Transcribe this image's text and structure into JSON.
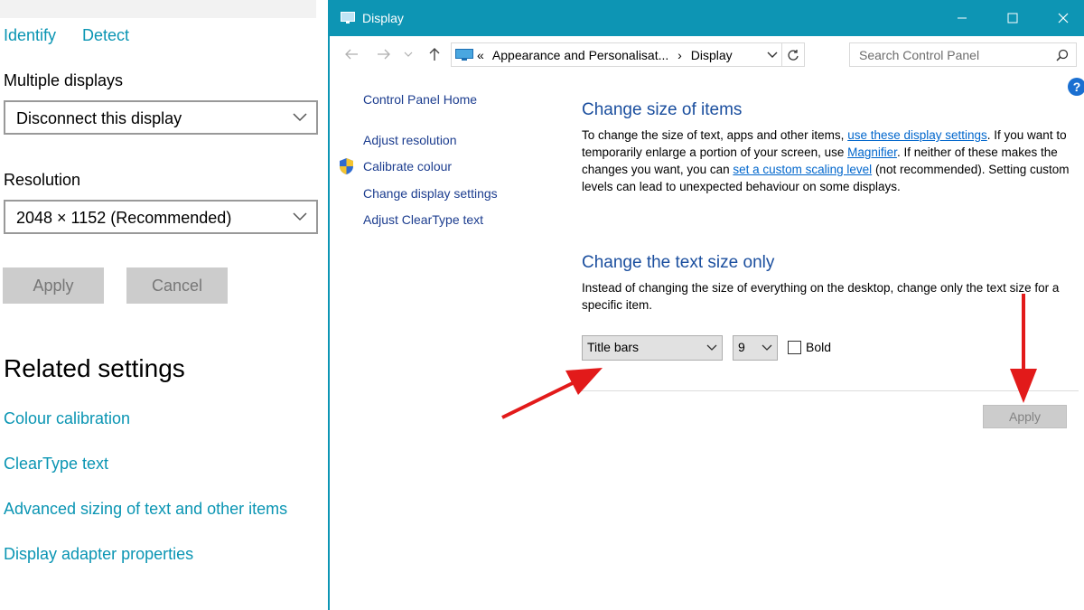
{
  "settings": {
    "links": {
      "identify": "Identify",
      "detect": "Detect"
    },
    "multiple_displays_label": "Multiple displays",
    "multiple_displays_value": "Disconnect this display",
    "resolution_label": "Resolution",
    "resolution_value": "2048 × 1152 (Recommended)",
    "apply_label": "Apply",
    "cancel_label": "Cancel",
    "related_title": "Related settings",
    "related_links": [
      "Colour calibration",
      "ClearType text",
      "Advanced sizing of text and other items",
      "Display adapter properties"
    ]
  },
  "window": {
    "title": "Display",
    "breadcrumb": {
      "prefix": "«",
      "parent": "Appearance and Personalisat...",
      "sep": "›",
      "current": "Display"
    },
    "search_placeholder": "Search Control Panel",
    "help": "?",
    "sidenav": [
      "Control Panel Home",
      "Adjust resolution",
      "Calibrate colour",
      "Change display settings",
      "Adjust ClearType text"
    ],
    "section1": {
      "title": "Change size of items",
      "t1": "To change the size of text, apps and other items, ",
      "link1": "use these display settings",
      "t2": ". If you want to temporarily enlarge a portion of your screen, use ",
      "link2": "Magnifier",
      "t3": ". If neither of these makes the changes you want, you can ",
      "link3": "set a custom scaling level",
      "t4": " (not recommended). Setting custom levels can lead to unexpected behaviour on some displays."
    },
    "section2": {
      "title": "Change the text size only",
      "desc": "Instead of changing the size of everything on the desktop, change only the text size for a specific item.",
      "item_value": "Title bars",
      "size_value": "9",
      "bold_label": "Bold",
      "bold_checked": false,
      "apply_label": "Apply"
    }
  },
  "colors": {
    "settings_link": "#0a95b3",
    "titlebar": "#0d95b4",
    "heading_blue": "#1a4e9e",
    "annotation_arrow": "#e21a1a"
  },
  "icons": [
    "monitor-icon",
    "minimize-icon",
    "maximize-icon",
    "close-icon",
    "back-arrow-icon",
    "forward-arrow-icon",
    "up-arrow-icon",
    "refresh-icon",
    "search-icon",
    "shield-icon",
    "help-icon",
    "chevron-down-icon"
  ]
}
